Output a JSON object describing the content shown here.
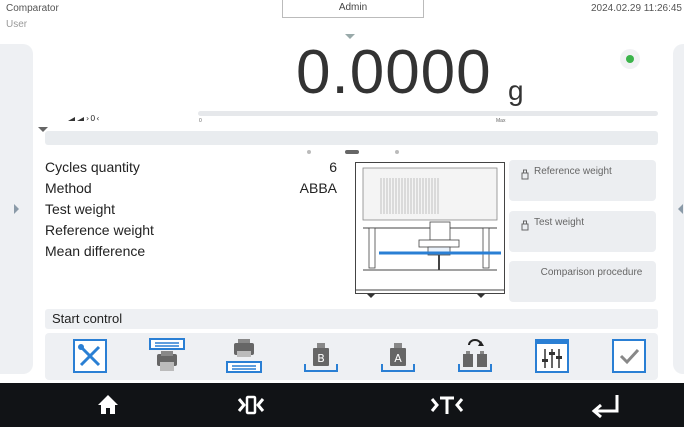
{
  "header": {
    "app_title": "Comparator",
    "user_label": "User",
    "admin_tab": "Admin",
    "datetime": "2024.02.29 11:26:45"
  },
  "weighing": {
    "value": "0.0000",
    "unit": "g",
    "range_min": "0",
    "range_max": "Max",
    "stable_color": "#3cb44b"
  },
  "params": {
    "labels": [
      "Cycles quantity",
      "Method",
      "Test weight",
      "Reference weight",
      "Mean difference"
    ],
    "values": [
      "6",
      "ABBA",
      "",
      "",
      ""
    ]
  },
  "buttons": {
    "reference_weight": "Reference weight",
    "test_weight": "Test weight",
    "comparison_procedure": "Comparison procedure"
  },
  "start_control": "Start control",
  "toolbar": {
    "items": [
      "settings-icon",
      "printout-header-icon",
      "printout-footer-icon",
      "weight-b-icon",
      "weight-a-icon",
      "swap-weights-icon",
      "parameters-icon",
      "confirm-icon"
    ]
  },
  "bottom_nav": {
    "items": [
      "home-icon",
      "zero-icon",
      "tare-icon",
      "enter-icon"
    ]
  },
  "colors": {
    "accent_blue": "#2a7fd4",
    "nav_bg": "#111316",
    "panel_bg": "#eef0f3"
  }
}
